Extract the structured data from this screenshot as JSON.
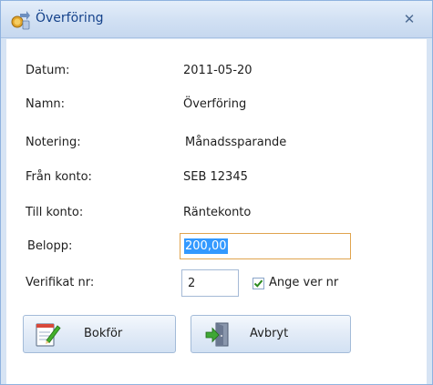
{
  "window": {
    "title": "Överföring",
    "close_glyph": "✕"
  },
  "fields": {
    "datum_label": "Datum:",
    "datum_value": "2011-05-20",
    "namn_label": "Namn:",
    "namn_value": "Överföring",
    "notering_label": "Notering:",
    "notering_value": "Månadssparande",
    "fran_label": "Från konto:",
    "fran_value": "SEB 12345",
    "till_label": "Till konto:",
    "till_value": "Räntekonto",
    "belopp_label": "Belopp:",
    "belopp_value": "200,00",
    "verifikat_label": "Verifikat nr:",
    "verifikat_value": "2",
    "ange_label": "Ange ver nr",
    "ange_checked": true
  },
  "buttons": {
    "book_label": "Bokför",
    "cancel_label": "Avbryt"
  },
  "icons": {
    "title": "money-transfer-icon",
    "close": "close-icon",
    "book": "notepad-pencil-icon",
    "cancel": "exit-door-arrow-icon"
  },
  "colors": {
    "title_text": "#15428b",
    "selection": "#3399ff",
    "focus_border": "#e0a44e"
  }
}
